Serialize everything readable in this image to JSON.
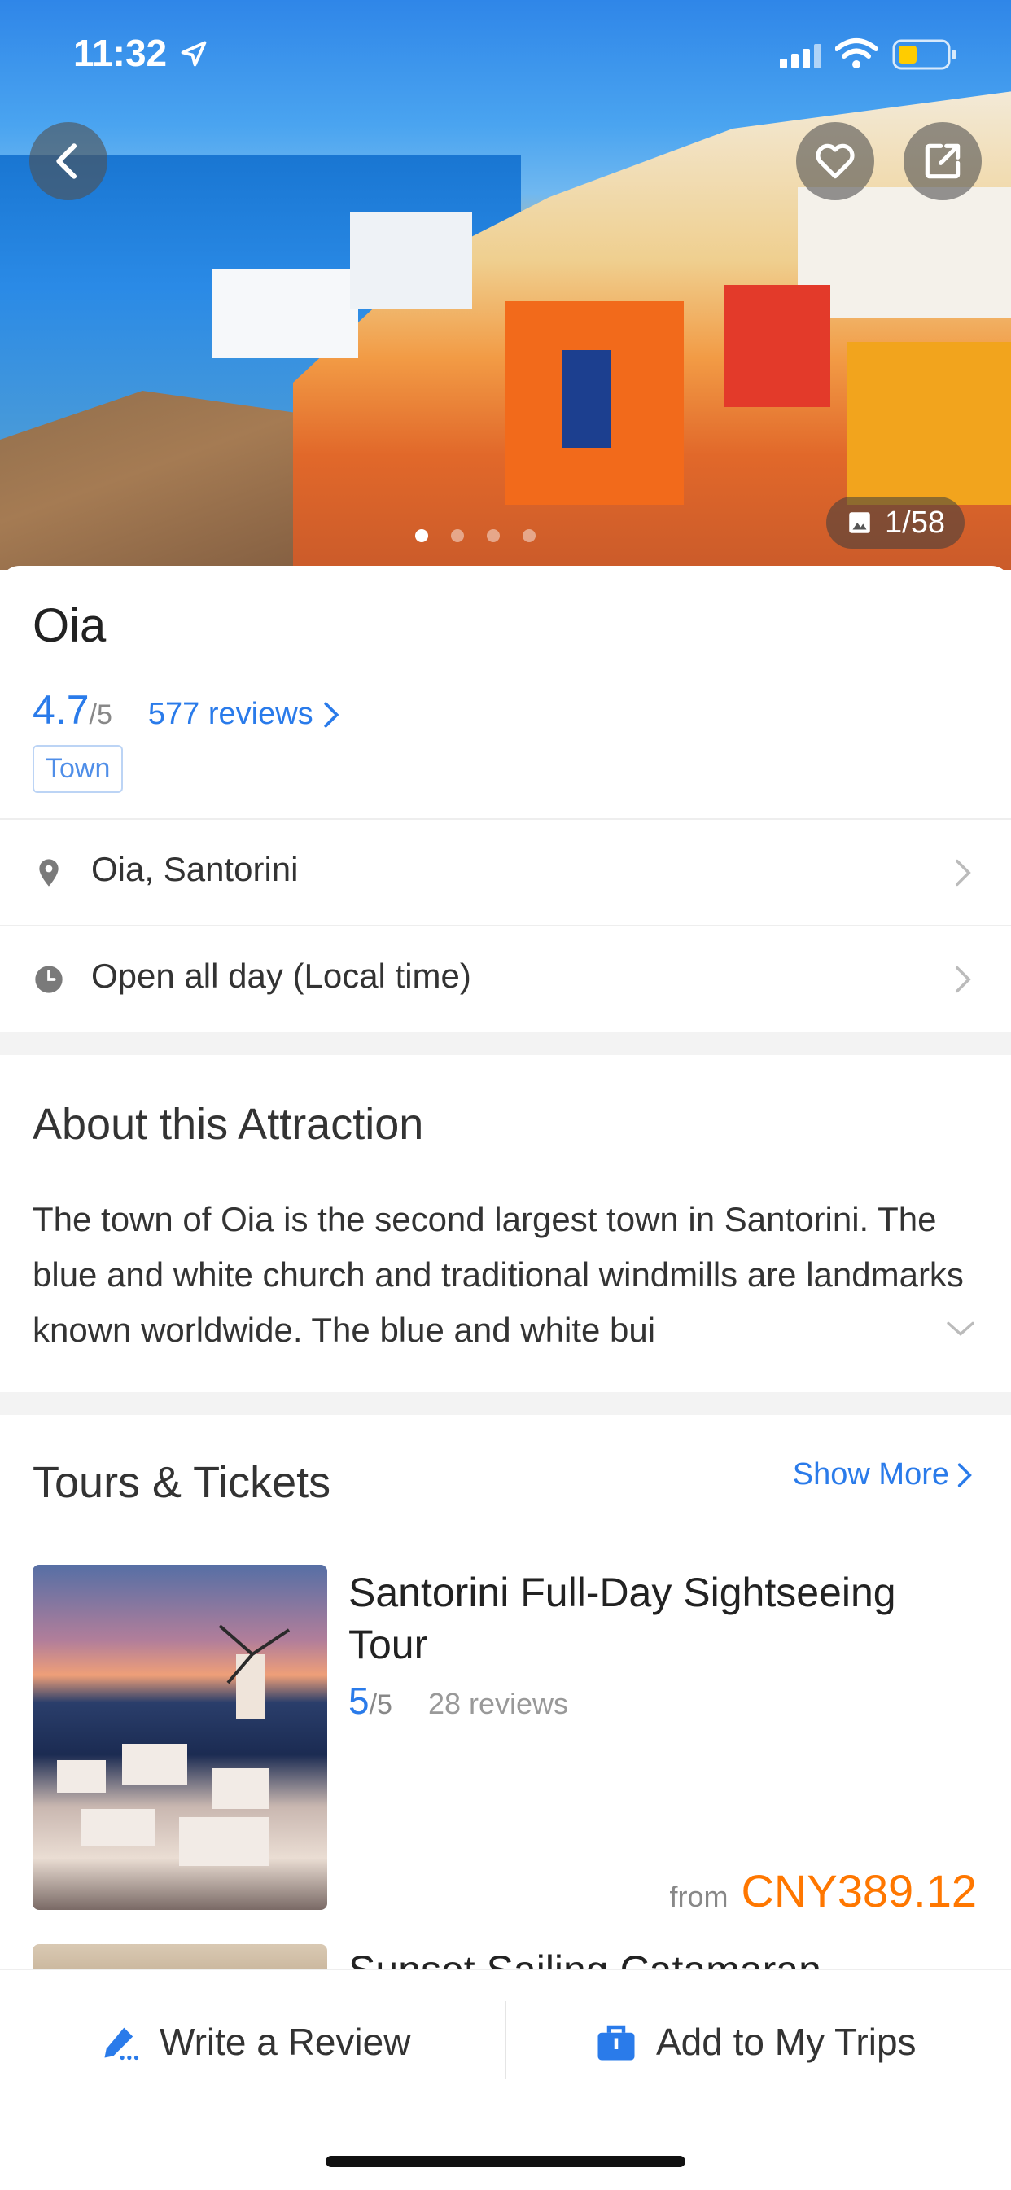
{
  "status_bar": {
    "time": "11:32"
  },
  "hero": {
    "photo_counter": "1/58",
    "slide_count": 4,
    "active_slide": 1
  },
  "attraction": {
    "name": "Oia",
    "rating": "4.7",
    "rating_max": "/5",
    "reviews_label": "577 reviews",
    "tag": "Town",
    "location": "Oia, Santorini",
    "hours": "Open all day (Local time)"
  },
  "about": {
    "heading": "About this Attraction",
    "text": "The town of Oia is the second largest town in Santorini. The blue and white church and traditional windmills are landmarks known worldwide. The blue and white bui"
  },
  "tours": {
    "heading": "Tours & Tickets",
    "show_more": "Show More",
    "items": [
      {
        "title": "Santorini Full-Day Sightseeing Tour",
        "rating": "5",
        "rating_max": "/5",
        "reviews": "28 reviews",
        "price_prefix": "from",
        "price": "CNY389.12"
      },
      {
        "title": "Sunset Sailing Catamaran"
      }
    ]
  },
  "bottom_bar": {
    "write_review": "Write a Review",
    "add_trips": "Add to My Trips"
  },
  "colors": {
    "accent": "#2a7bea",
    "price": "#ff7700"
  }
}
